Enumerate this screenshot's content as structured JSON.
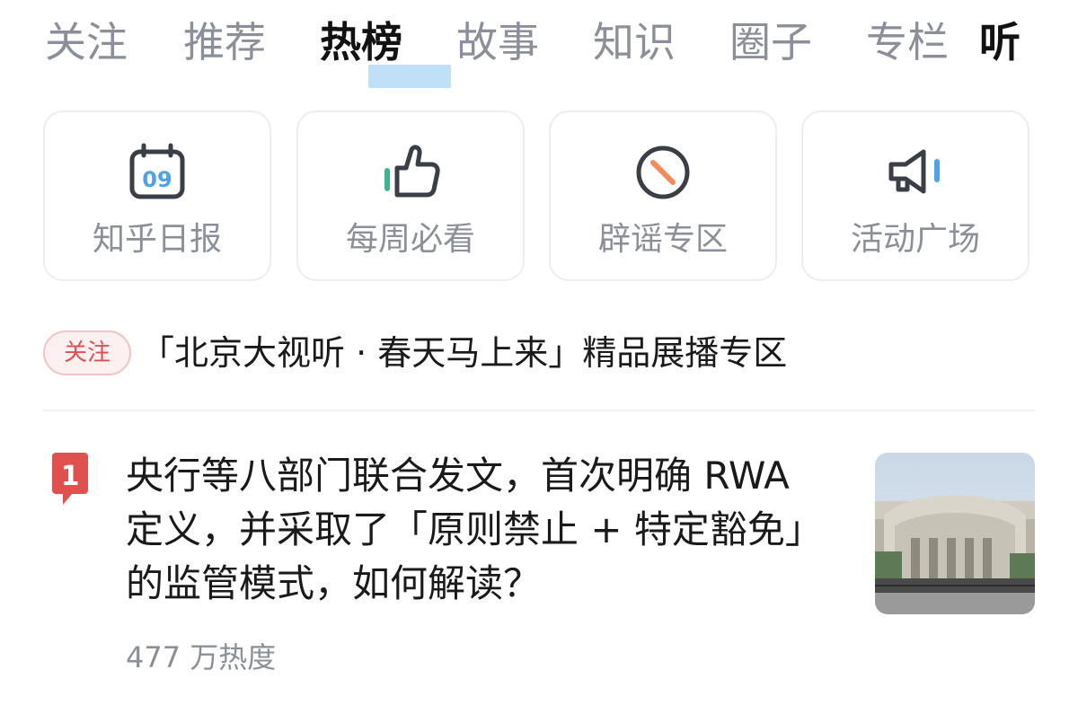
{
  "tabs": [
    {
      "label": "关注"
    },
    {
      "label": "推荐"
    },
    {
      "label": "热榜"
    },
    {
      "label": "故事"
    },
    {
      "label": "知识"
    },
    {
      "label": "圈子"
    },
    {
      "label": "专栏"
    },
    {
      "label": "听"
    }
  ],
  "active_tab": "热榜",
  "shortcuts": [
    {
      "label": "知乎日报",
      "icon": "calendar-icon",
      "icon_text": "09"
    },
    {
      "label": "每周必看",
      "icon": "thumbs-up-icon"
    },
    {
      "label": "辟谣专区",
      "icon": "no-entry-icon"
    },
    {
      "label": "活动广场",
      "icon": "megaphone-icon"
    }
  ],
  "follow": {
    "badge": "关注",
    "text": "「北京大视听 · 春天马上来」精品展播专区"
  },
  "hot_list": [
    {
      "rank": "1",
      "title": "央行等八部门联合发文，首次明确 RWA 定义，并采取了「原则禁止 + 特定豁免」的监管模式，如何解读？",
      "heat": "477 万热度",
      "thumbnail": "bank-building-image"
    }
  ],
  "colors": {
    "accent_blue": "#4ca3e8",
    "accent_green": "#3fb38f",
    "accent_orange": "#f28a5c",
    "accent_red": "#e0504f",
    "muted_text": "#8a8f99",
    "tab_underline": "#bfe0f7"
  }
}
